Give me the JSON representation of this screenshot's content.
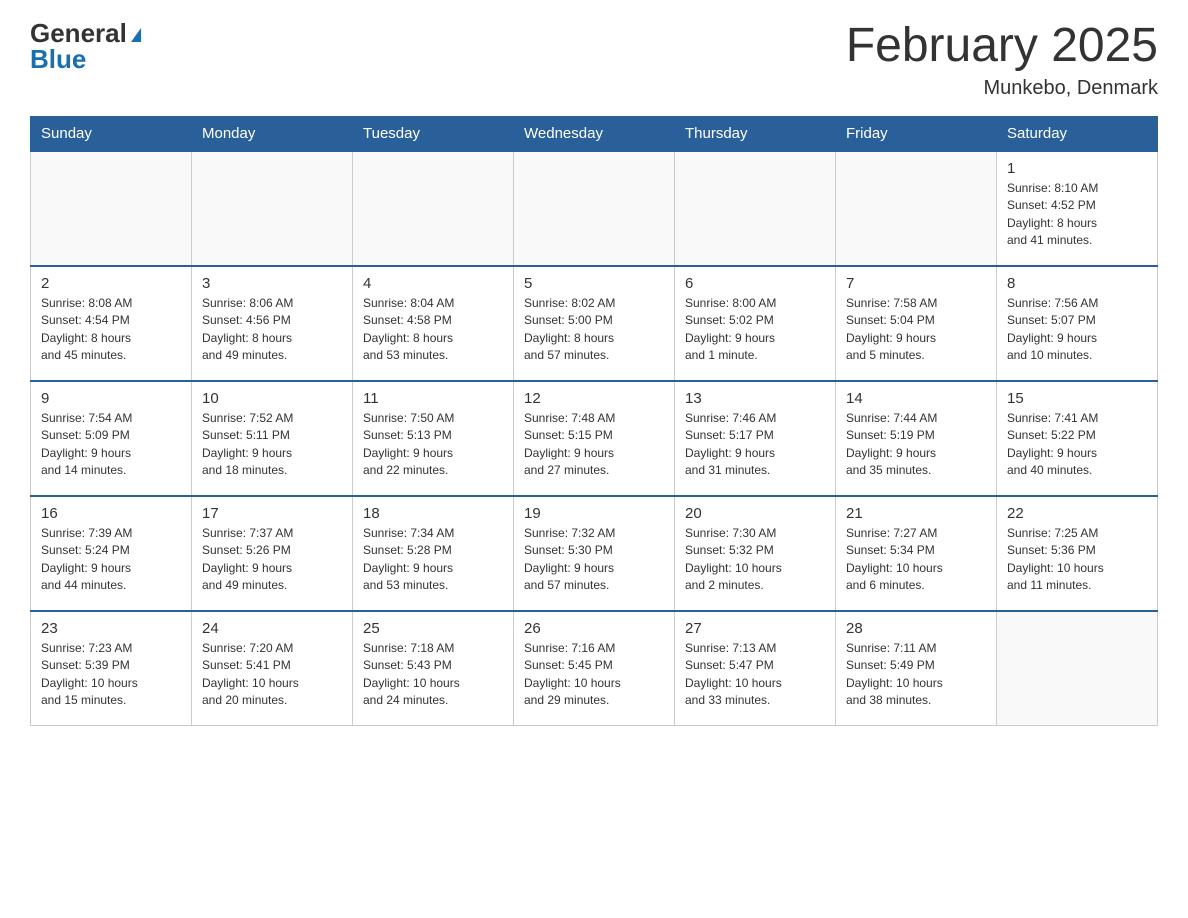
{
  "logo": {
    "general": "General",
    "blue": "Blue"
  },
  "title": "February 2025",
  "location": "Munkebo, Denmark",
  "days_of_week": [
    "Sunday",
    "Monday",
    "Tuesday",
    "Wednesday",
    "Thursday",
    "Friday",
    "Saturday"
  ],
  "weeks": [
    [
      {
        "day": "",
        "info": ""
      },
      {
        "day": "",
        "info": ""
      },
      {
        "day": "",
        "info": ""
      },
      {
        "day": "",
        "info": ""
      },
      {
        "day": "",
        "info": ""
      },
      {
        "day": "",
        "info": ""
      },
      {
        "day": "1",
        "info": "Sunrise: 8:10 AM\nSunset: 4:52 PM\nDaylight: 8 hours\nand 41 minutes."
      }
    ],
    [
      {
        "day": "2",
        "info": "Sunrise: 8:08 AM\nSunset: 4:54 PM\nDaylight: 8 hours\nand 45 minutes."
      },
      {
        "day": "3",
        "info": "Sunrise: 8:06 AM\nSunset: 4:56 PM\nDaylight: 8 hours\nand 49 minutes."
      },
      {
        "day": "4",
        "info": "Sunrise: 8:04 AM\nSunset: 4:58 PM\nDaylight: 8 hours\nand 53 minutes."
      },
      {
        "day": "5",
        "info": "Sunrise: 8:02 AM\nSunset: 5:00 PM\nDaylight: 8 hours\nand 57 minutes."
      },
      {
        "day": "6",
        "info": "Sunrise: 8:00 AM\nSunset: 5:02 PM\nDaylight: 9 hours\nand 1 minute."
      },
      {
        "day": "7",
        "info": "Sunrise: 7:58 AM\nSunset: 5:04 PM\nDaylight: 9 hours\nand 5 minutes."
      },
      {
        "day": "8",
        "info": "Sunrise: 7:56 AM\nSunset: 5:07 PM\nDaylight: 9 hours\nand 10 minutes."
      }
    ],
    [
      {
        "day": "9",
        "info": "Sunrise: 7:54 AM\nSunset: 5:09 PM\nDaylight: 9 hours\nand 14 minutes."
      },
      {
        "day": "10",
        "info": "Sunrise: 7:52 AM\nSunset: 5:11 PM\nDaylight: 9 hours\nand 18 minutes."
      },
      {
        "day": "11",
        "info": "Sunrise: 7:50 AM\nSunset: 5:13 PM\nDaylight: 9 hours\nand 22 minutes."
      },
      {
        "day": "12",
        "info": "Sunrise: 7:48 AM\nSunset: 5:15 PM\nDaylight: 9 hours\nand 27 minutes."
      },
      {
        "day": "13",
        "info": "Sunrise: 7:46 AM\nSunset: 5:17 PM\nDaylight: 9 hours\nand 31 minutes."
      },
      {
        "day": "14",
        "info": "Sunrise: 7:44 AM\nSunset: 5:19 PM\nDaylight: 9 hours\nand 35 minutes."
      },
      {
        "day": "15",
        "info": "Sunrise: 7:41 AM\nSunset: 5:22 PM\nDaylight: 9 hours\nand 40 minutes."
      }
    ],
    [
      {
        "day": "16",
        "info": "Sunrise: 7:39 AM\nSunset: 5:24 PM\nDaylight: 9 hours\nand 44 minutes."
      },
      {
        "day": "17",
        "info": "Sunrise: 7:37 AM\nSunset: 5:26 PM\nDaylight: 9 hours\nand 49 minutes."
      },
      {
        "day": "18",
        "info": "Sunrise: 7:34 AM\nSunset: 5:28 PM\nDaylight: 9 hours\nand 53 minutes."
      },
      {
        "day": "19",
        "info": "Sunrise: 7:32 AM\nSunset: 5:30 PM\nDaylight: 9 hours\nand 57 minutes."
      },
      {
        "day": "20",
        "info": "Sunrise: 7:30 AM\nSunset: 5:32 PM\nDaylight: 10 hours\nand 2 minutes."
      },
      {
        "day": "21",
        "info": "Sunrise: 7:27 AM\nSunset: 5:34 PM\nDaylight: 10 hours\nand 6 minutes."
      },
      {
        "day": "22",
        "info": "Sunrise: 7:25 AM\nSunset: 5:36 PM\nDaylight: 10 hours\nand 11 minutes."
      }
    ],
    [
      {
        "day": "23",
        "info": "Sunrise: 7:23 AM\nSunset: 5:39 PM\nDaylight: 10 hours\nand 15 minutes."
      },
      {
        "day": "24",
        "info": "Sunrise: 7:20 AM\nSunset: 5:41 PM\nDaylight: 10 hours\nand 20 minutes."
      },
      {
        "day": "25",
        "info": "Sunrise: 7:18 AM\nSunset: 5:43 PM\nDaylight: 10 hours\nand 24 minutes."
      },
      {
        "day": "26",
        "info": "Sunrise: 7:16 AM\nSunset: 5:45 PM\nDaylight: 10 hours\nand 29 minutes."
      },
      {
        "day": "27",
        "info": "Sunrise: 7:13 AM\nSunset: 5:47 PM\nDaylight: 10 hours\nand 33 minutes."
      },
      {
        "day": "28",
        "info": "Sunrise: 7:11 AM\nSunset: 5:49 PM\nDaylight: 10 hours\nand 38 minutes."
      },
      {
        "day": "",
        "info": ""
      }
    ]
  ]
}
